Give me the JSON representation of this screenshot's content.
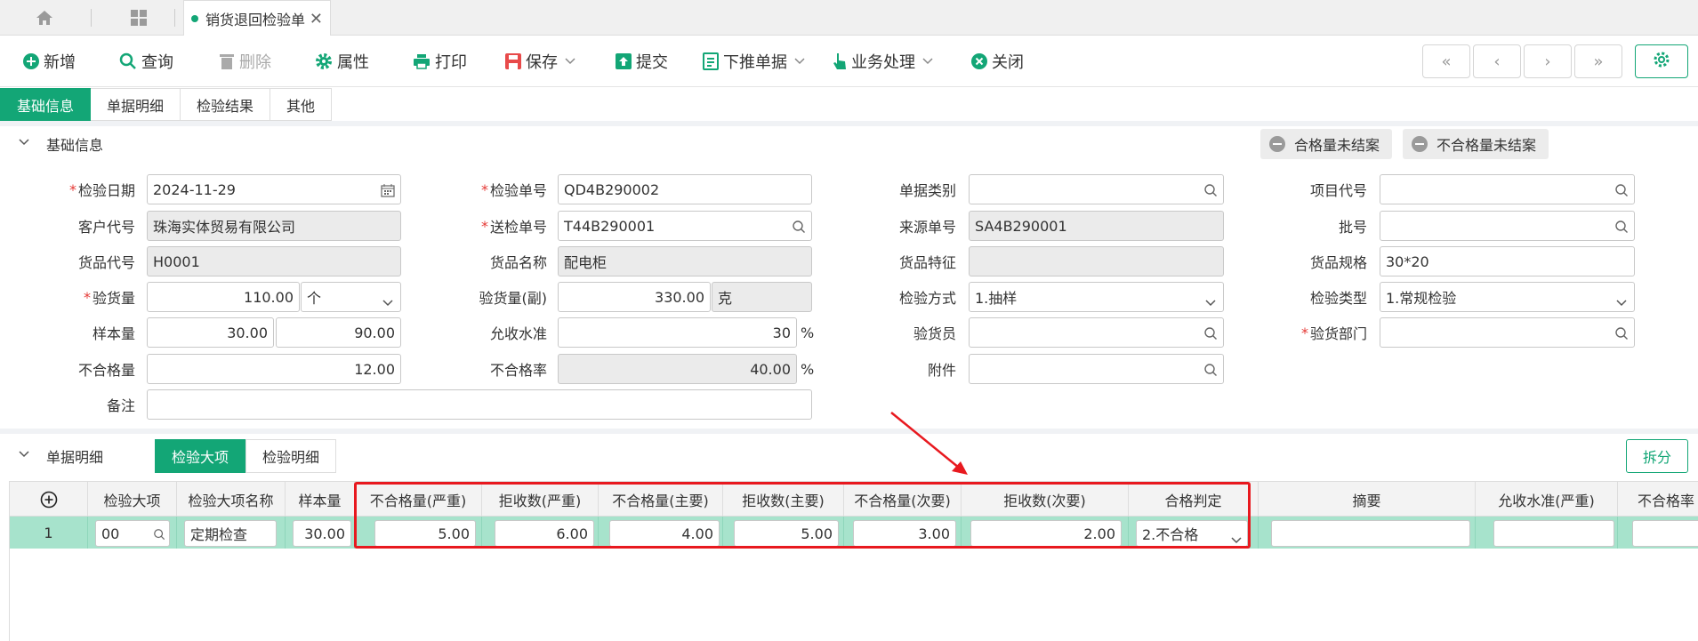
{
  "tabbar": {
    "doc_tab_label": "销货退回检验单",
    "close_glyph": "✕",
    "home_icon": "home-icon",
    "apps_icon": "grid-icon"
  },
  "toolbar": {
    "items": [
      {
        "label": "新增",
        "icon": "add-circle-icon"
      },
      {
        "label": "查询",
        "icon": "search-icon"
      },
      {
        "label": "删除",
        "icon": "trash-icon",
        "disabled": true
      },
      {
        "label": "属性",
        "icon": "gear-icon"
      },
      {
        "label": "打印",
        "icon": "printer-icon"
      },
      {
        "label": "保存",
        "icon": "save-icon",
        "dropdown": true
      },
      {
        "label": "提交",
        "icon": "submit-icon"
      },
      {
        "label": "下推单据",
        "icon": "document-icon",
        "dropdown": true
      },
      {
        "label": "业务处理",
        "icon": "hand-icon",
        "dropdown": true
      },
      {
        "label": "关闭",
        "icon": "close-circle-icon"
      }
    ],
    "nav": [
      "«",
      "‹",
      "›",
      "»"
    ]
  },
  "subtabs": [
    "基础信息",
    "单据明细",
    "检验结果",
    "其他"
  ],
  "basic_section": {
    "title": "基础信息",
    "chips": [
      "合格量未结案",
      "不合格量未结案"
    ]
  },
  "form": {
    "inspect_date": {
      "label": "检验日期",
      "value": "2024-11-29"
    },
    "inspect_no": {
      "label": "检验单号",
      "value": "QD4B290002"
    },
    "doc_type": {
      "label": "单据类别",
      "value": ""
    },
    "project_code": {
      "label": "项目代号",
      "value": ""
    },
    "customer_code": {
      "label": "客户代号",
      "value": "珠海实体贸易有限公司"
    },
    "send_no": {
      "label": "送检单号",
      "value": "T44B290001"
    },
    "source_no": {
      "label": "来源单号",
      "value": "SA4B290001"
    },
    "batch_no": {
      "label": "批号",
      "value": ""
    },
    "item_code": {
      "label": "货品代号",
      "value": "H0001"
    },
    "item_name": {
      "label": "货品名称",
      "value": "配电柜"
    },
    "item_feature": {
      "label": "货品特征",
      "value": ""
    },
    "item_spec": {
      "label": "货品规格",
      "value": "30*20"
    },
    "inspect_qty": {
      "label": "验货量",
      "value": "110.00",
      "unit": "个"
    },
    "inspect_qty2": {
      "label": "验货量(副)",
      "value": "330.00",
      "unit": "克"
    },
    "inspect_method": {
      "label": "检验方式",
      "value": "1.抽样"
    },
    "inspect_type": {
      "label": "检验类型",
      "value": "1.常规检验"
    },
    "sample_qty": {
      "label": "样本量",
      "value": "30.00",
      "value2": "90.00"
    },
    "accept_level": {
      "label": "允收水准",
      "value": "30",
      "unit": "%"
    },
    "inspector": {
      "label": "验货员",
      "value": ""
    },
    "inspect_dept": {
      "label": "验货部门",
      "value": ""
    },
    "fail_qty": {
      "label": "不合格量",
      "value": "12.00"
    },
    "fail_rate": {
      "label": "不合格率",
      "value": "40.00",
      "unit": "%"
    },
    "attachment": {
      "label": "附件",
      "value": ""
    },
    "remark": {
      "label": "备注",
      "value": ""
    }
  },
  "detail_section": {
    "title": "单据明细",
    "tabs": [
      "检验大项",
      "检验明细"
    ],
    "split_label": "拆分"
  },
  "grid": {
    "headers": [
      "检验大项",
      "检验大项名称",
      "样本量",
      "不合格量(严重)",
      "拒收数(严重)",
      "不合格量(主要)",
      "拒收数(主要)",
      "不合格量(次要)",
      "拒收数(次要)",
      "合格判定",
      "摘要",
      "允收水准(严重)",
      "不合格率"
    ],
    "row": {
      "index": "1",
      "item": "00",
      "item_name": "定期检查",
      "sample": "30.00",
      "fail_critical": "5.00",
      "reject_critical": "6.00",
      "fail_major": "4.00",
      "reject_major": "5.00",
      "fail_minor": "3.00",
      "reject_minor": "2.00",
      "judgement": "2.不合格",
      "summary": "",
      "accept_critical": ""
    }
  },
  "colors": {
    "accent": "#13a676",
    "highlight": "#e8191f"
  }
}
